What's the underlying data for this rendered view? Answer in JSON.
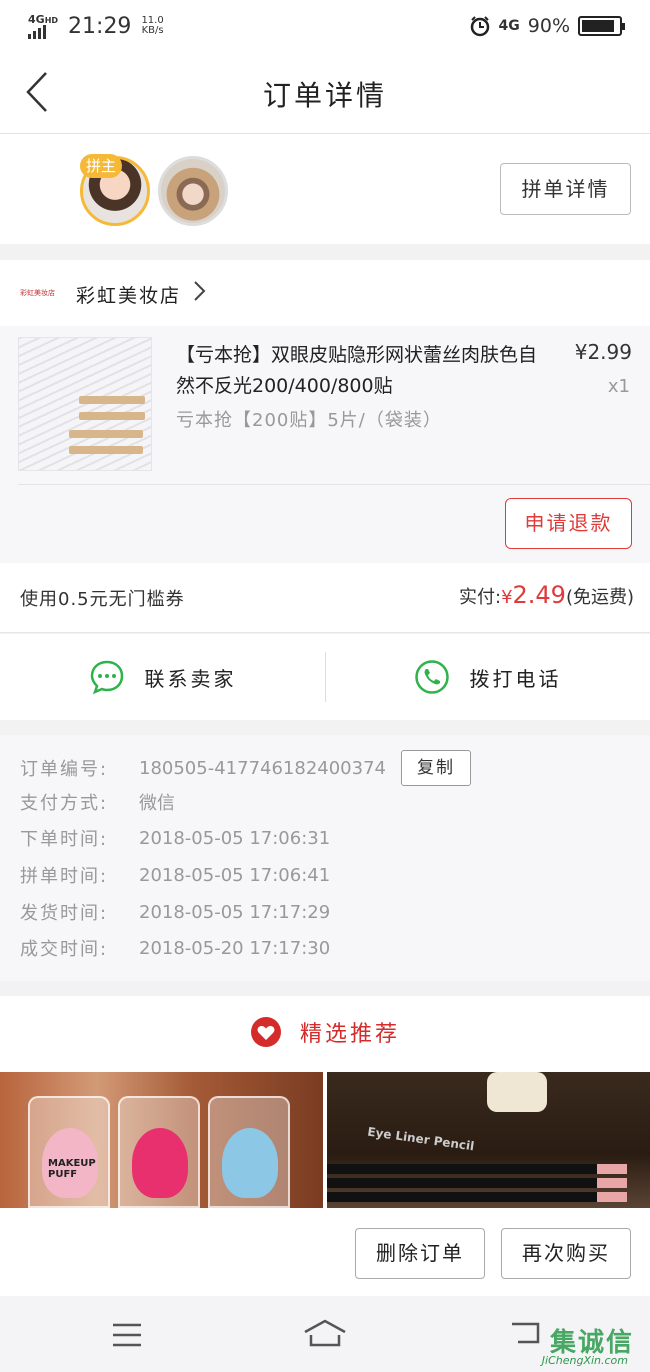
{
  "status_bar": {
    "network": "4G",
    "network_sup": "HD",
    "time": "21:29",
    "speed_value": "11.0",
    "speed_unit": "KB/s",
    "network_right": "4G",
    "battery": "90%",
    "battery_level": 0.9
  },
  "nav": {
    "title": "订单详情",
    "back_icon": "chevron-left-icon"
  },
  "group": {
    "host_tag": "拼主",
    "detail_button": "拼单详情"
  },
  "store": {
    "logo_text": "彩虹美妆店",
    "name": "彩虹美妆店"
  },
  "product": {
    "title": "【亏本抢】双眼皮贴隐形网状蕾丝肉肤色自然不反光200/400/800贴",
    "price": "¥2.99",
    "qty": "x1",
    "spec": "亏本抢【200贴】5片/（袋装）",
    "refund_button": "申请退款"
  },
  "payment": {
    "coupon": "使用0.5元无门槛券",
    "paid_label": "实付:",
    "currency": "¥",
    "paid_amount": "2.49",
    "shipping_note": "(免运费)"
  },
  "contact": {
    "seller_label": "联系卖家",
    "call_label": "拨打电话"
  },
  "order_info": {
    "copy_button": "复制",
    "rows": [
      {
        "label": "订单编号:",
        "value": "180505-417746182400374"
      },
      {
        "label": "支付方式:",
        "value": "微信"
      },
      {
        "label": "下单时间:",
        "value": "2018-05-05 17:06:31"
      },
      {
        "label": "拼单时间:",
        "value": "2018-05-05 17:06:41"
      },
      {
        "label": "发货时间:",
        "value": "2018-05-05 17:17:29"
      },
      {
        "label": "成交时间:",
        "value": "2018-05-20 17:17:30"
      }
    ]
  },
  "recommend": {
    "title": "精选推荐",
    "item_a_label": "MAKEUP PUFF",
    "item_b_label": "Eye Liner Pencil"
  },
  "actions": {
    "delete": "删除订单",
    "rebuy": "再次购买"
  },
  "watermark": {
    "text": "集诚信",
    "sub": "JiChengXin.com"
  },
  "colors": {
    "accent": "#e03a3a",
    "wechat_green": "#2db34a",
    "host_gold": "#f5b937"
  }
}
